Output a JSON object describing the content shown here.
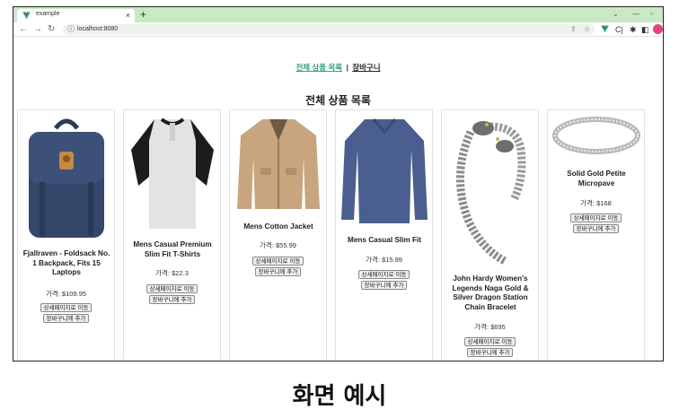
{
  "browser": {
    "tab_title": "example",
    "tab_close": "×",
    "new_tab": "+",
    "url": "localhost:8080",
    "colors": {
      "tabstrip": "#c9e9c3",
      "vue_green": "#41b883",
      "profile": "#e2447f"
    }
  },
  "nav": {
    "products_link": "전체 상품 목록",
    "separator": "|",
    "cart_link": "장바구니"
  },
  "heading": "전체 상품 목록",
  "products": [
    {
      "title": "Fjallraven - Foldsack No. 1 Backpack, Fits 15 Laptops",
      "price": "가격: $109.95",
      "detail_btn": "상세페이지로 이동",
      "cart_btn": "장바구니에 추가",
      "image_icon": "backpack-image"
    },
    {
      "title": "Mens Casual Premium Slim Fit T-Shirts",
      "price": "가격: $22.3",
      "detail_btn": "상세페이지로 이동",
      "cart_btn": "장바구니에 추가",
      "image_icon": "tshirt-image"
    },
    {
      "title": "Mens Cotton Jacket",
      "price": "가격: $55.99",
      "detail_btn": "상세페이지로 이동",
      "cart_btn": "장바구니에 추가",
      "image_icon": "jacket-image"
    },
    {
      "title": "Mens Casual Slim Fit",
      "price": "가격: $15.99",
      "detail_btn": "상세페이지로 이동",
      "cart_btn": "장바구니에 추가",
      "image_icon": "long-sleeve-image"
    },
    {
      "title": "John Hardy Women's Legends Naga Gold & Silver Dragon Station Chain Bracelet",
      "price": "가격: $695",
      "detail_btn": "상세페이지로 이동",
      "cart_btn": "장바구니에 추가",
      "image_icon": "bracelet-image"
    },
    {
      "title": "Solid Gold Petite Micropave",
      "price": "가격: $168",
      "detail_btn": "상세페이지로 이동",
      "cart_btn": "장바구니에 추가",
      "image_icon": "ring-image"
    }
  ],
  "caption": "화면 예시"
}
